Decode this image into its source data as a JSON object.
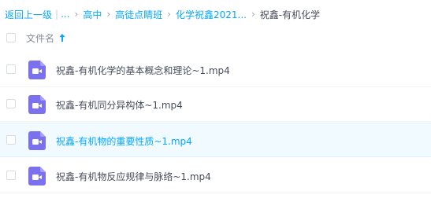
{
  "breadcrumb": {
    "back": "返回上一级",
    "ellipsis": "...",
    "items": [
      "高中",
      "高徒点睛班",
      "化学祝鑫2021..."
    ],
    "current": "祝鑫-有机化学"
  },
  "header": {
    "column_name": "文件名",
    "sort": "ascending"
  },
  "files": [
    {
      "name": "祝鑫-有机化学的基本概念和理论~1.mp4",
      "icon": "video-file-icon",
      "highlighted": false
    },
    {
      "name": "祝鑫-有机同分异构体~1.mp4",
      "icon": "video-file-icon",
      "highlighted": false
    },
    {
      "name": "祝鑫-有机物的重要性质~1.mp4",
      "icon": "video-file-icon",
      "highlighted": true
    },
    {
      "name": "祝鑫-有机物反应规律与脉络~1.mp4",
      "icon": "video-file-icon",
      "highlighted": false
    }
  ],
  "colors": {
    "accent": "#06a7ff",
    "text": "#454d5a",
    "muted": "#878c9c",
    "icon": "#7b71ef",
    "highlight_bg": "#f0faff"
  }
}
